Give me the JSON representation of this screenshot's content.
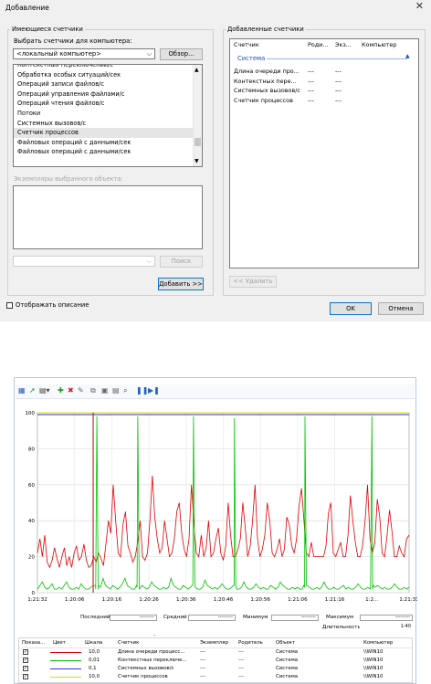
{
  "dialog": {
    "title": "Добавление",
    "available_group": "Имеющиеся счетчики",
    "select_label": "Выбрать счетчики для компьютера:",
    "computer_value": "<локальный компьютер>",
    "browse_btn": "Обзор...",
    "counters": [
      "Контекстных переключений/с",
      "Обработка особых ситуаций/сек",
      "Операций записи файлов/с",
      "Операций управления файлами/с",
      "Операций чтения файлов/с",
      "Потоки",
      "Системных вызовов/с",
      "Счетчик процессов",
      "Файловых операций с данными/сек",
      "Файловых операций с данными/сек"
    ],
    "instances_label": "Экземпляры выбранного объекта:",
    "search_btn": "Поиск",
    "add_btn": "Добавить >>",
    "added_group": "Добавленные счетчики",
    "added_headers": [
      "Счетчик",
      "Роди...",
      "Экз...",
      "Компьютер"
    ],
    "added_category": "Система",
    "added_rows": [
      {
        "name": "Длина очереди про...",
        "parent": "---",
        "inst": "---"
      },
      {
        "name": "Контекстных пере...",
        "parent": "---",
        "inst": "---"
      },
      {
        "name": "Системных вызовов/с",
        "parent": "---",
        "inst": "---"
      },
      {
        "name": "Счетчик процессов",
        "parent": "---",
        "inst": "---"
      }
    ],
    "remove_btn": "<< Удалить",
    "show_desc": "Отображать описание",
    "ok_btn": "OK",
    "cancel_btn": "Отмена"
  },
  "perfmon": {
    "toolbar_icons": [
      "view-graph-icon",
      "refresh-icon",
      "chart-type-icon",
      "add-counter-icon",
      "delete-counter-icon",
      "highlight-icon",
      "copy-properties-icon",
      "paste-counters-icon",
      "properties-icon",
      "zoom-icon",
      "pause-icon",
      "next-frame-icon"
    ],
    "stats": {
      "last_label": "Последний",
      "last_value": "---------",
      "avg_label": "Средний",
      "avg_value": "---------",
      "min_label": "Минимум",
      "min_value": "---------",
      "max_label": "Максимум",
      "max_value": "---------",
      "duration_label": "Длительность",
      "duration_value": "1:40"
    },
    "legend_headers": [
      "Показа...",
      "Цвет",
      "Шкала",
      "Счетчик",
      "Экземпляр",
      "Родитель",
      "Объект",
      "Компьютер"
    ],
    "legend_rows": [
      {
        "color": "#e00000",
        "scale": "10,0",
        "counter": "Длина очереди процесс...",
        "inst": "---",
        "parent": "---",
        "object": "Система",
        "computer": "\\\\WIN10"
      },
      {
        "color": "#00c000",
        "scale": "0,01",
        "counter": "Контекстных переключе...",
        "inst": "---",
        "parent": "---",
        "object": "Система",
        "computer": "\\\\WIN10"
      },
      {
        "color": "#3030d0",
        "scale": "0,1",
        "counter": "Системных вызовов/с",
        "inst": "---",
        "parent": "---",
        "object": "Система",
        "computer": "\\\\WIN10"
      },
      {
        "color": "#d8d800",
        "scale": "10,0",
        "counter": "Счетчик процессов",
        "inst": "---",
        "parent": "---",
        "object": "Система",
        "computer": "\\\\WIN10"
      }
    ]
  },
  "chart_data": {
    "type": "line",
    "ylim": [
      0,
      100
    ],
    "y_ticks": [
      "100",
      "80",
      "60",
      "40",
      "20",
      "0"
    ],
    "x_ticks": [
      "1:21:32",
      "1:20:06",
      "1:20:16",
      "1:20:26",
      "1:20:36",
      "1:20:46",
      "1:20:56",
      "1:21:06",
      "1:21:16",
      "1:2...",
      "1:21:31"
    ],
    "series": [
      {
        "name": "Длина очереди процесс...",
        "color": "#e00000",
        "values": [
          22,
          30,
          20,
          32,
          17,
          14,
          18,
          25,
          19,
          14,
          20,
          25,
          15,
          20,
          14,
          22,
          26,
          18,
          20,
          27,
          18,
          14,
          15,
          20,
          17,
          22,
          19,
          15,
          27,
          40,
          33,
          60,
          40,
          22,
          20,
          38,
          45,
          26,
          22,
          17,
          20,
          28,
          40,
          20,
          18,
          22,
          40,
          65,
          42,
          30,
          22,
          25,
          40,
          30,
          20,
          22,
          30,
          45,
          50,
          33,
          24,
          20,
          30,
          60,
          38,
          22,
          20,
          32,
          20,
          25,
          40,
          20,
          22,
          30,
          36,
          22,
          18,
          26,
          50,
          32,
          20,
          20,
          24,
          30,
          50,
          36,
          20,
          26,
          40,
          60,
          30,
          20,
          24,
          32,
          50,
          40,
          22,
          20,
          24,
          30,
          20,
          24,
          42,
          38,
          26,
          22,
          30,
          48,
          58,
          40,
          22,
          20,
          28,
          20,
          20,
          20,
          20,
          20,
          26,
          44,
          50,
          22,
          20,
          24,
          28,
          20,
          20,
          32,
          54,
          40,
          28,
          20,
          20,
          26,
          40,
          60,
          30,
          22,
          28,
          52,
          42,
          22,
          20,
          32,
          46,
          34,
          20,
          20,
          26,
          22,
          20,
          30,
          32
        ]
      },
      {
        "name": "Контекстных переключе...",
        "color": "#00c000",
        "values": [
          2,
          4,
          6,
          3,
          2,
          3,
          5,
          2,
          2,
          3,
          2,
          4,
          6,
          3,
          2,
          2,
          3,
          2,
          5,
          3,
          2,
          2,
          3,
          4,
          2,
          2,
          3,
          8,
          4,
          3,
          2,
          4,
          3,
          2,
          3,
          5,
          8,
          4,
          3,
          2,
          2,
          3,
          2,
          4,
          3,
          2,
          3,
          6,
          4,
          3,
          2,
          2,
          3,
          2,
          3,
          8,
          4,
          3,
          2,
          2,
          4,
          3,
          2,
          3,
          5,
          3,
          2,
          2,
          3,
          7,
          4,
          3,
          2,
          3,
          2,
          3,
          5,
          3,
          2,
          2,
          3,
          4,
          2,
          2,
          3,
          6,
          3,
          2,
          2,
          3,
          5,
          3,
          2,
          3,
          2,
          2,
          4,
          3,
          2,
          3,
          6,
          4,
          3,
          2,
          2,
          3,
          2,
          3,
          2,
          2,
          3,
          4,
          3,
          2,
          2,
          3,
          2,
          3,
          6,
          3,
          2,
          2,
          3,
          2,
          2,
          3,
          4,
          2,
          3,
          2,
          2,
          3,
          5,
          3,
          2,
          2,
          3,
          2,
          2,
          3,
          4,
          3,
          2,
          3,
          2,
          2,
          3,
          5,
          3,
          2,
          2,
          3,
          2,
          3
        ],
        "spikes": [
          [
            0.16,
            98
          ],
          [
            0.27,
            98
          ],
          [
            0.42,
            98
          ],
          [
            0.53,
            97
          ],
          [
            0.72,
            98
          ],
          [
            0.9,
            98
          ]
        ]
      },
      {
        "name": "Системных вызовов/с",
        "color": "#3030d0",
        "values": [
          99,
          99,
          99,
          99,
          99,
          99,
          99,
          99,
          99,
          99
        ]
      },
      {
        "name": "Счетчик процессов",
        "color": "#d8d800",
        "values": [
          100,
          100,
          100,
          100,
          100,
          100,
          100,
          100,
          100,
          100
        ]
      }
    ]
  }
}
